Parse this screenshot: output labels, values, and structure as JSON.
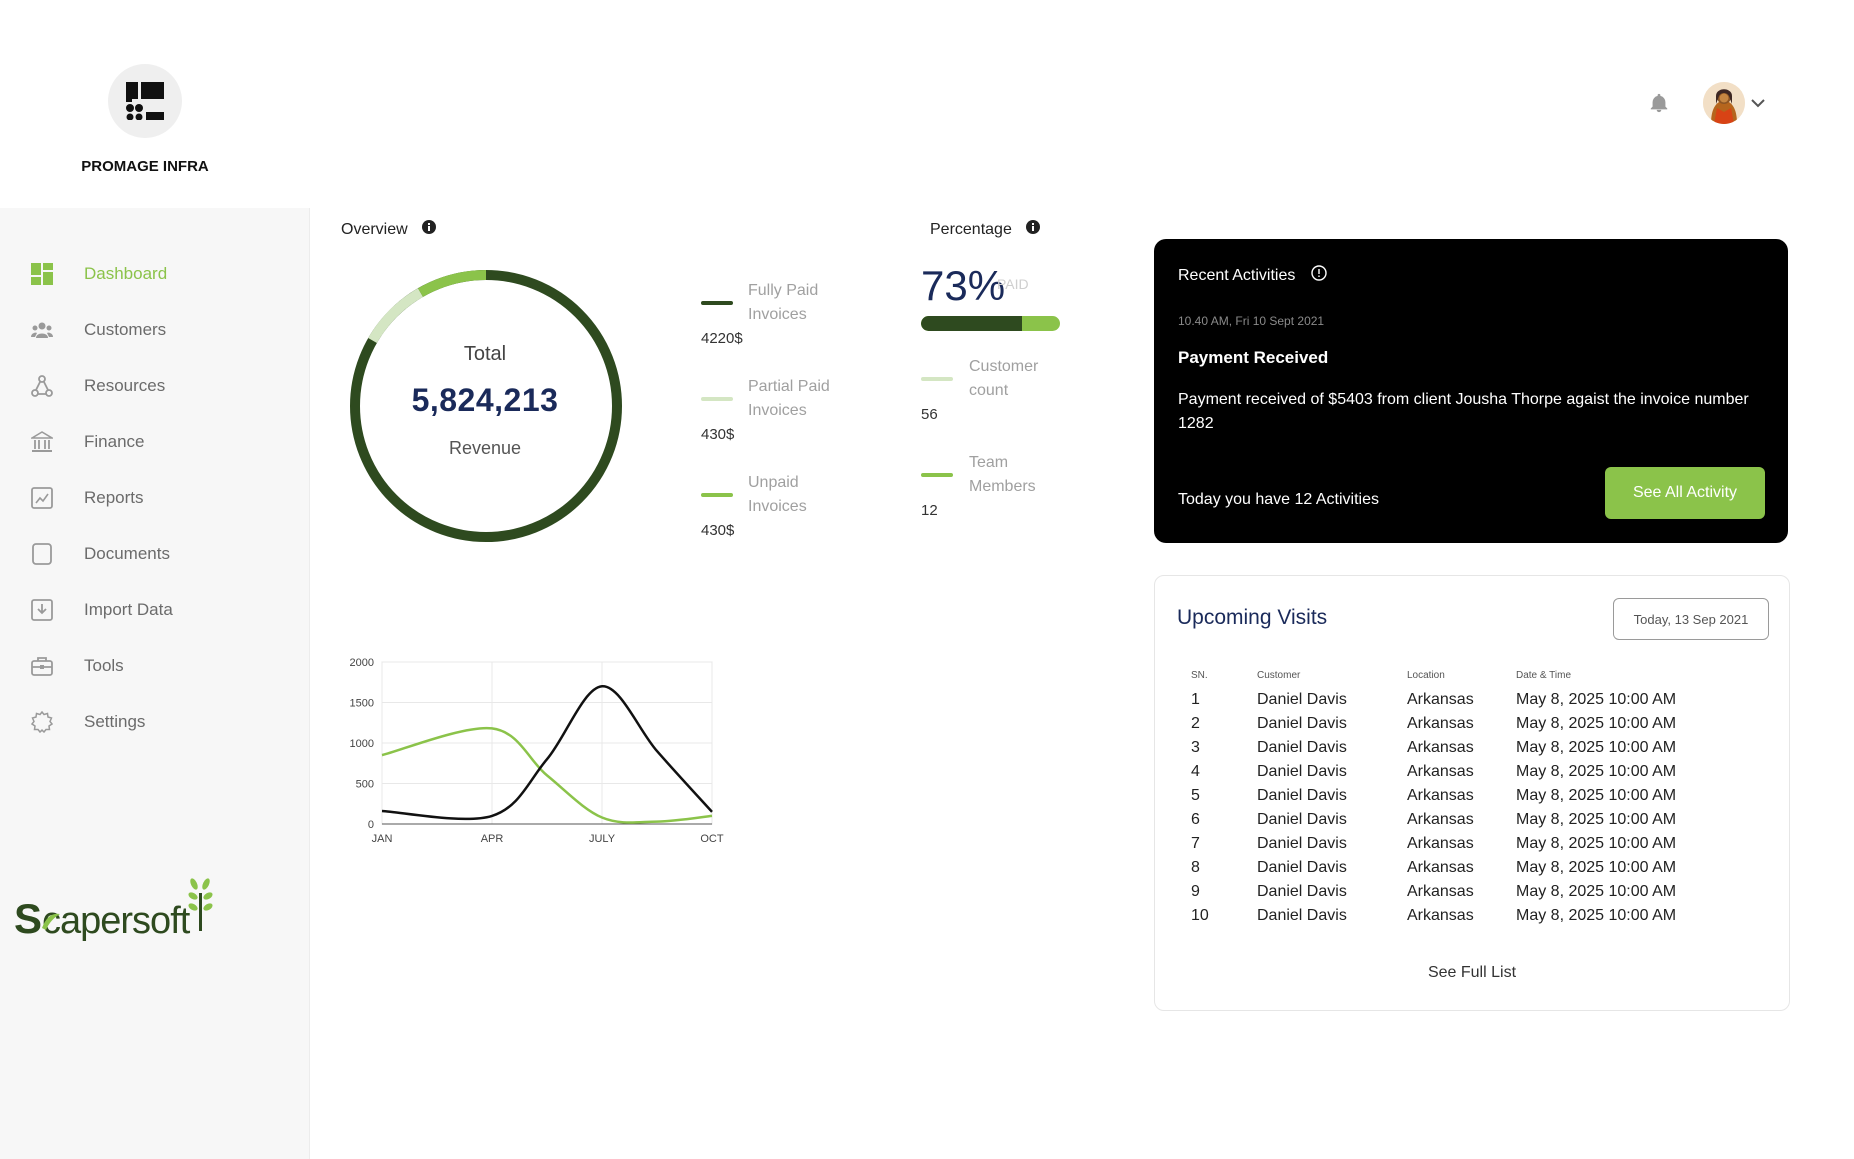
{
  "brand": {
    "name": "PROMAGE INFRA",
    "footer_logo_text": "Scapersoft"
  },
  "colors": {
    "accent": "#8bc34a",
    "dark_green": "#2e4a1f",
    "light_green": "#d4e6c3",
    "navy": "#1a2a5a"
  },
  "header": {
    "bell_icon": "bell-icon",
    "avatar_icon": "user-avatar"
  },
  "sidebar": {
    "items": [
      {
        "label": "Dashboard",
        "icon": "dashboard-icon",
        "active": true
      },
      {
        "label": "Customers",
        "icon": "customers-icon"
      },
      {
        "label": "Resources",
        "icon": "resources-icon"
      },
      {
        "label": "Finance",
        "icon": "bank-icon"
      },
      {
        "label": "Reports",
        "icon": "reports-icon"
      },
      {
        "label": "Documents",
        "icon": "documents-icon"
      },
      {
        "label": "Import Data",
        "icon": "import-icon"
      },
      {
        "label": "Tools",
        "icon": "toolbox-icon"
      },
      {
        "label": "Settings",
        "icon": "gear-icon"
      }
    ]
  },
  "overview": {
    "title": "Overview",
    "total_label": "Total",
    "total_value": "5,824,213",
    "revenue_label": "Revenue",
    "legend": [
      {
        "label": "Fully Paid Invoices",
        "value": "4220$",
        "color": "#2e4a1f"
      },
      {
        "label": "Partial Paid Invoices",
        "value": "430$",
        "color": "#d4e6c3"
      },
      {
        "label": "Unpaid Invoices",
        "value": "430$",
        "color": "#8bc34a"
      }
    ]
  },
  "percentage": {
    "title": "Percentage",
    "value": "73%",
    "paid_label": "PAID",
    "paid_fraction": 0.73,
    "legend": [
      {
        "label": "Customer count",
        "value": "56",
        "color": "#d4e6c3"
      },
      {
        "label": "Team Members",
        "value": "12",
        "color": "#8bc34a"
      }
    ]
  },
  "chart_data": {
    "type": "line",
    "categories": [
      "JAN",
      "APR",
      "JULY",
      "OCT"
    ],
    "ylim": [
      0,
      2000
    ],
    "yticks": [
      0,
      500,
      1000,
      1500,
      2000
    ],
    "grid": true,
    "series": [
      {
        "color": "#8bc34a",
        "x": [
          0,
          1,
          1.5,
          2,
          2.5,
          3
        ],
        "values": [
          850,
          1180,
          600,
          80,
          30,
          100
        ]
      },
      {
        "color": "#111111",
        "x": [
          0,
          1,
          1.5,
          2,
          2.5,
          3
        ],
        "values": [
          160,
          100,
          800,
          1700,
          900,
          150
        ]
      }
    ]
  },
  "recent": {
    "title": "Recent Activities",
    "timestamp": "10.40 AM, Fri 10 Sept 2021",
    "heading": "Payment Received",
    "message": "Payment received of $5403 from client Jousha Thorpe agaist the invoice number 1282",
    "count_text": "Today you have 12 Activities",
    "button": "See All Activity"
  },
  "upcoming": {
    "title": "Upcoming Visits",
    "date": "Today, 13 Sep 2021",
    "columns": [
      "SN.",
      "Customer",
      "Location",
      "Date & Time"
    ],
    "rows": [
      [
        "1",
        "Daniel Davis",
        "Arkansas",
        "May 8, 2025 10:00 AM"
      ],
      [
        "2",
        "Daniel Davis",
        "Arkansas",
        "May 8, 2025 10:00 AM"
      ],
      [
        "3",
        "Daniel Davis",
        "Arkansas",
        "May 8, 2025 10:00 AM"
      ],
      [
        "4",
        "Daniel Davis",
        "Arkansas",
        "May 8, 2025 10:00 AM"
      ],
      [
        "5",
        "Daniel Davis",
        "Arkansas",
        "May 8, 2025 10:00 AM"
      ],
      [
        "6",
        "Daniel Davis",
        "Arkansas",
        "May 8, 2025 10:00 AM"
      ],
      [
        "7",
        "Daniel Davis",
        "Arkansas",
        "May 8, 2025 10:00 AM"
      ],
      [
        "8",
        "Daniel Davis",
        "Arkansas",
        "May 8, 2025 10:00 AM"
      ],
      [
        "9",
        "Daniel Davis",
        "Arkansas",
        "May 8, 2025 10:00 AM"
      ],
      [
        "10",
        "Daniel Davis",
        "Arkansas",
        "May 8, 2025 10:00 AM"
      ]
    ],
    "see_full": "See Full List"
  }
}
